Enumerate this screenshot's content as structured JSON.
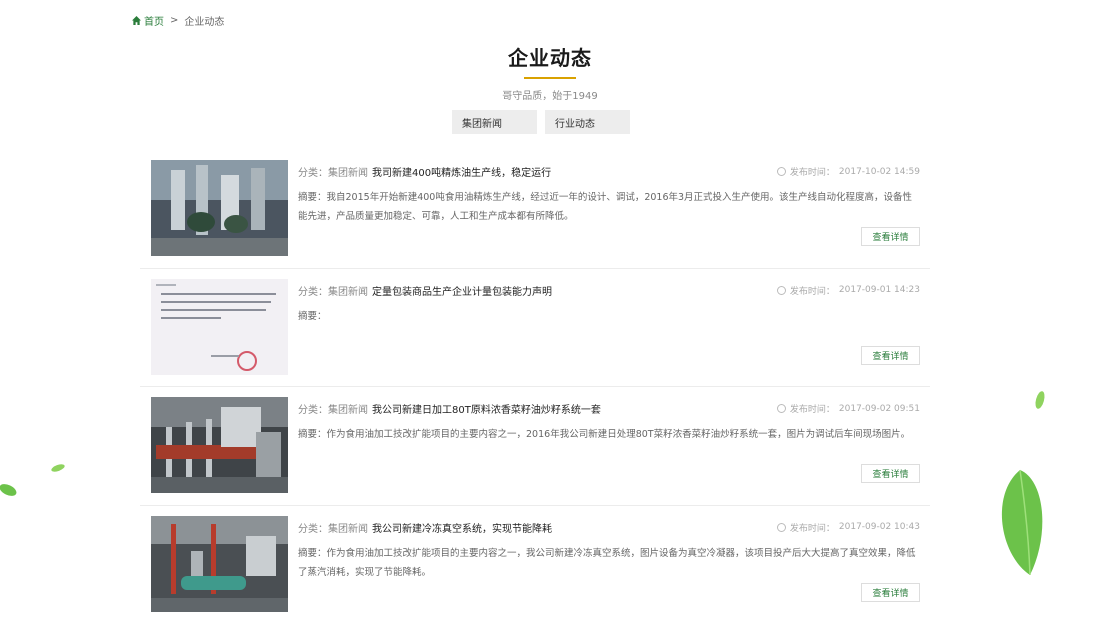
{
  "breadcrumb": {
    "home": "首页",
    "separator": ">",
    "current": "企业动态"
  },
  "page": {
    "title": "企业动态",
    "subtitle": "哥守品质，始于1949"
  },
  "tabs": [
    {
      "label": "集团新闻"
    },
    {
      "label": "行业动态"
    }
  ],
  "labels": {
    "category_prefix": "分类：",
    "date_prefix": "发布时间：",
    "summary_prefix": "摘要：",
    "more": "查看详情"
  },
  "news": [
    {
      "category": "集团新闻",
      "title": "我司新建400吨精炼油生产线，稳定运行",
      "date": "2017-10-02 14:59",
      "summary": "我自2015年开始新建400吨食用油精炼生产线，经过近一年的设计、调试，2016年3月正式投入生产使用。该生产线自动化程度高，设备性能先进，产品质量更加稳定、可靠，人工和生产成本都有所降低。"
    },
    {
      "category": "集团新闻",
      "title": "定量包装商品生产企业计量包装能力声明",
      "date": "2017-09-01 14:23",
      "summary": ""
    },
    {
      "category": "集团新闻",
      "title": "我公司新建日加工80T原料浓香菜籽油炒籽系统一套",
      "date": "2017-09-02 09:51",
      "summary": "作为食用油加工技改扩能项目的主要内容之一，2016年我公司新建日处理80T菜籽浓香菜籽油炒籽系统一套，图片为调试后车间现场图片。"
    },
    {
      "category": "集团新闻",
      "title": "我公司新建冷冻真空系统，实现节能降耗",
      "date": "2017-09-02 10:43",
      "summary": "作为食用油加工技改扩能项目的主要内容之一，我公司新建冷冻真空系统，图片设备为真空冷凝器，该项目投产后大大提高了真空效果，降低了蒸汽消耗，实现了节能降耗。"
    }
  ],
  "colors": {
    "accent_green": "#2a7d3b",
    "title_rule": "#d9a100"
  }
}
